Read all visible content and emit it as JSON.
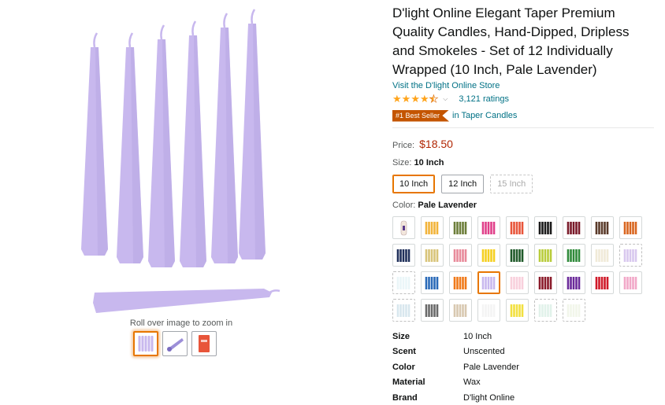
{
  "product": {
    "title": "D'light Online Elegant Taper Premium Quality Candles, Hand-Dipped, Dripless and Smokeles - Set of 12 Individually Wrapped (10 Inch, Pale Lavender)",
    "store_link": "Visit the D'light Online Store",
    "rating": 4.5,
    "ratings_count": "3,121 ratings",
    "badge": "#1 Best Seller",
    "badge_category": "in Taper Candles",
    "price_label": "Price:",
    "price": "$18.50",
    "size_label": "Size:",
    "size_value": "10 Inch",
    "sizes": [
      {
        "label": "10 Inch",
        "state": "selected"
      },
      {
        "label": "12 Inch",
        "state": "available"
      },
      {
        "label": "15 Inch",
        "state": "unavailable"
      }
    ],
    "color_label": "Color:",
    "color_value": "Pale Lavender"
  },
  "media": {
    "zoom_hint": "Roll over image to zoom in",
    "main_color": "#c8b8ee",
    "thumbnails": [
      {
        "icon": "lavender-candles-thumbnail",
        "color": "#c8b8ee",
        "selected": true
      },
      {
        "icon": "lavender-candle-lying-thumbnail",
        "color": "#9c8fd8",
        "selected": false
      },
      {
        "icon": "packaged-candle-thumbnail",
        "color": "#e8553a",
        "selected": false
      }
    ]
  },
  "swatches": [
    {
      "color": "#f2e6dc",
      "state": "available",
      "variant": "bottle"
    },
    {
      "color": "#f2b43a",
      "state": "available"
    },
    {
      "color": "#6d7e3a",
      "state": "available"
    },
    {
      "color": "#e0408a",
      "state": "available"
    },
    {
      "color": "#e8553a",
      "state": "available"
    },
    {
      "color": "#1a1a1a",
      "state": "available"
    },
    {
      "color": "#7a1a2a",
      "state": "available"
    },
    {
      "color": "#5a3a2a",
      "state": "available"
    },
    {
      "color": "#d9661f",
      "state": "available"
    },
    {
      "color": "#1f2f5a",
      "state": "available"
    },
    {
      "color": "#d8c47a",
      "state": "available"
    },
    {
      "color": "#e88a9a",
      "state": "available"
    },
    {
      "color": "#f5d020",
      "state": "available"
    },
    {
      "color": "#1f5a2a",
      "state": "available"
    },
    {
      "color": "#b8cc3a",
      "state": "available"
    },
    {
      "color": "#2f8a3a",
      "state": "available"
    },
    {
      "color": "#f0ead8",
      "state": "available"
    },
    {
      "color": "#b89ae0",
      "state": "unavailable"
    },
    {
      "color": "#d8eef2",
      "state": "unavailable"
    },
    {
      "color": "#2a6ab8",
      "state": "available"
    },
    {
      "color": "#f07a1a",
      "state": "available"
    },
    {
      "color": "#c8b8ee",
      "state": "selected"
    },
    {
      "color": "#f8d0dc",
      "state": "available"
    },
    {
      "color": "#8a1a2a",
      "state": "available"
    },
    {
      "color": "#6a2a9a",
      "state": "available"
    },
    {
      "color": "#d01a2a",
      "state": "available"
    },
    {
      "color": "#f2a8c8",
      "state": "available"
    },
    {
      "color": "#b8d4e0",
      "state": "unavailable"
    },
    {
      "color": "#6a6a6a",
      "state": "available"
    },
    {
      "color": "#d8c8b0",
      "state": "available"
    },
    {
      "color": "#f4f4f4",
      "state": "available"
    },
    {
      "color": "#f2e040",
      "state": "available"
    },
    {
      "color": "#c8e8d8",
      "state": "unavailable"
    },
    {
      "color": "#e8eed8",
      "state": "unavailable"
    }
  ],
  "specs": [
    {
      "key": "Size",
      "value": "10 Inch"
    },
    {
      "key": "Scent",
      "value": "Unscented"
    },
    {
      "key": "Color",
      "value": "Pale Lavender"
    },
    {
      "key": "Material",
      "value": "Wax"
    },
    {
      "key": "Brand",
      "value": "D'light Online"
    }
  ]
}
